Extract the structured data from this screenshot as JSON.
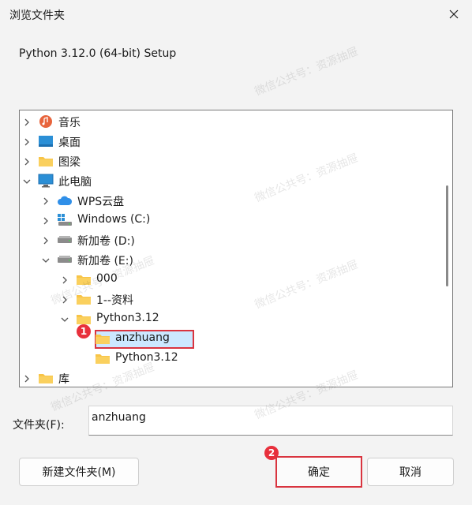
{
  "window": {
    "title": "浏览文件夹"
  },
  "subtitle": "Python 3.12.0 (64-bit) Setup",
  "tree": {
    "items": [
      {
        "label": "音乐"
      },
      {
        "label": "桌面"
      },
      {
        "label": "图梁"
      },
      {
        "label": "此电脑"
      },
      {
        "label": "WPS云盘"
      },
      {
        "label": "Windows (C:)"
      },
      {
        "label": "新加卷 (D:)"
      },
      {
        "label": "新加卷 (E:)"
      },
      {
        "label": "000"
      },
      {
        "label": "1--资料"
      },
      {
        "label": "Python3.12"
      },
      {
        "label": "anzhuang"
      },
      {
        "label": "Python3.12"
      },
      {
        "label": "库"
      }
    ]
  },
  "annotations": {
    "step1": "1",
    "step2": "2"
  },
  "folder_field": {
    "label": "文件夹(F):",
    "value": "anzhuang"
  },
  "buttons": {
    "new_folder": "新建文件夹(M)",
    "ok": "确定",
    "cancel": "取消"
  },
  "watermark": "微信公共号：资源抽屉",
  "colors": {
    "highlight_border": "#d9343f",
    "selection_bg": "#cce8ff",
    "badge": "#e8303c",
    "folder": "#f8c447"
  }
}
